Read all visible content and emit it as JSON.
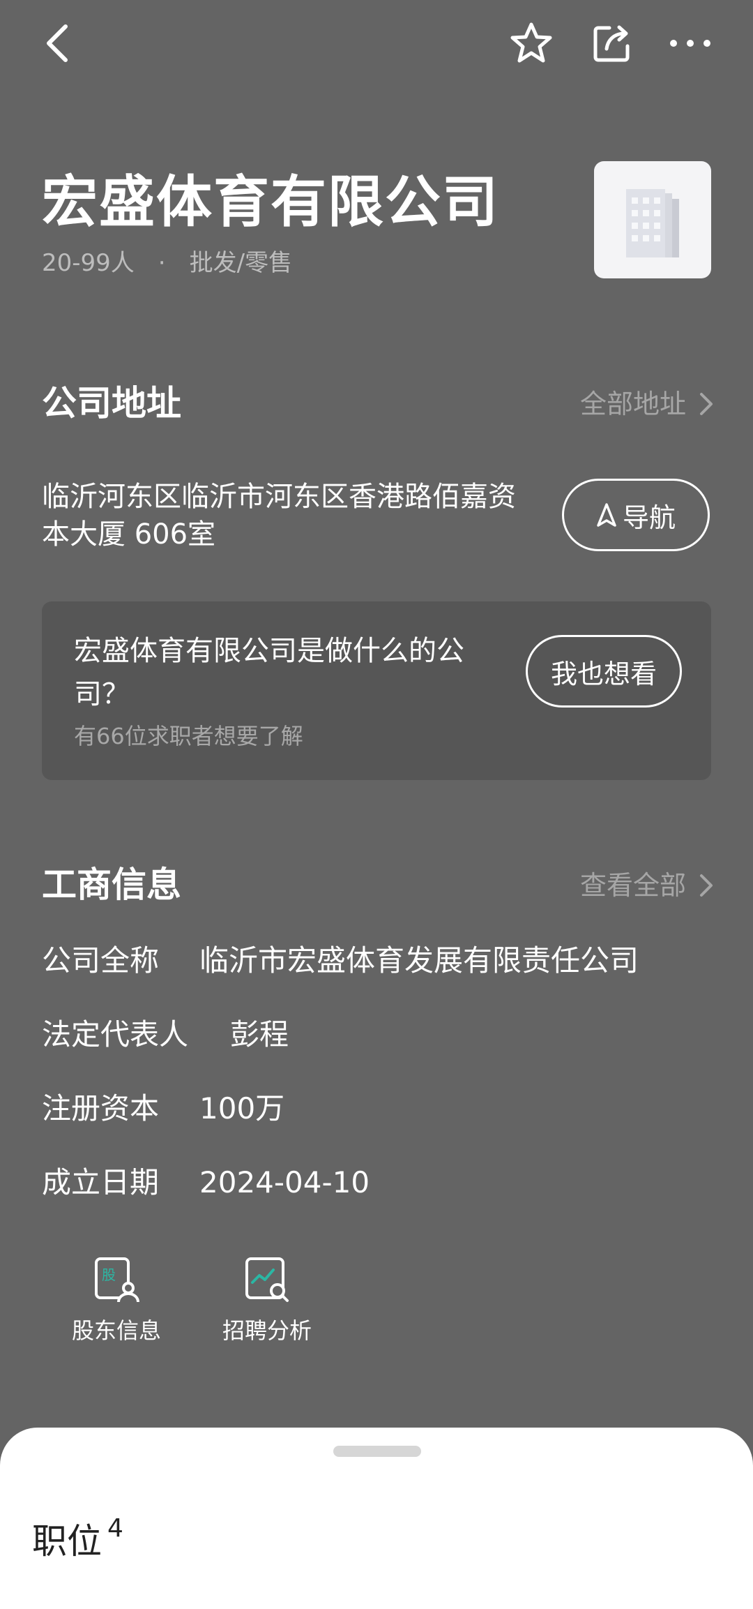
{
  "icons": {
    "back": "chevron-left-icon",
    "favorite": "star-outline-icon",
    "share": "share-icon",
    "more": "more-horizontal-icon"
  },
  "company": {
    "name": "宏盛体育有限公司",
    "size": "20-99人",
    "separator": "·",
    "industry": "批发/零售",
    "logo": "building-icon"
  },
  "address_section": {
    "title": "公司地址",
    "link": "全部地址",
    "address": "临沂河东区临沂市河东区香港路佰嘉资本大厦  606室",
    "navigate_label": "导航"
  },
  "question_card": {
    "question": "宏盛体育有限公司是做什么的公司？",
    "sub": "有66位求职者想要了解",
    "button": "我也想看"
  },
  "business_section": {
    "title": "工商信息",
    "link": "查看全部",
    "rows": [
      {
        "label": "公司全称",
        "value": "临沂市宏盛体育发展有限责任公司"
      },
      {
        "label": "法定代表人",
        "value": "彭程"
      },
      {
        "label": "注册资本",
        "value": "100万"
      },
      {
        "label": "成立日期",
        "value": "2024-04-10"
      }
    ]
  },
  "tools": [
    {
      "label": "股东信息",
      "icon": "shareholder-icon",
      "icon_text": "股"
    },
    {
      "label": "招聘分析",
      "icon": "recruitment-analysis-icon"
    }
  ],
  "sheet": {
    "title": "职位",
    "count": "4"
  },
  "colors": {
    "background": "#646464",
    "card": "#565656",
    "muted_text": "#a6a6a6",
    "accent_green": "#2bb7a4",
    "sheet": "#ffffff"
  }
}
